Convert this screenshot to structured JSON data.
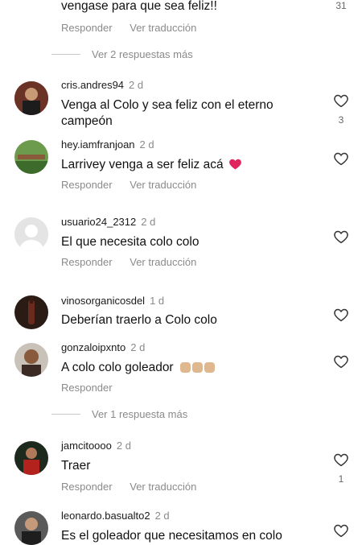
{
  "top_comment": {
    "text": "vengase para que sea feliz!!",
    "reply_label": "Responder",
    "translate_label": "Ver traducción",
    "likes": "31"
  },
  "replies_1": "Ver 2 respuestas más",
  "comments": [
    {
      "user": "cris.andres94",
      "when": "2 d",
      "text": "Venga al Colo y sea feliz con el eterno campeón",
      "likes": "3"
    },
    {
      "user": "hey.iamfranjoan",
      "when": "2 d",
      "text": "Larrivey venga a ser feliz acá",
      "reply_label": "Responder",
      "translate_label": "Ver traducción"
    },
    {
      "user": "usuario24_2312",
      "when": "2 d",
      "text": "El que necesita colo colo",
      "reply_label": "Responder",
      "translate_label": "Ver traducción"
    },
    {
      "user": "vinosorganicosdel",
      "when": "1 d",
      "text": "Deberían traerlo a Colo colo"
    },
    {
      "user": "gonzaloipxnto",
      "when": "2 d",
      "text": "A colo colo goleador",
      "reply_label": "Responder"
    },
    {
      "user": "jamcitoooo",
      "when": "2 d",
      "text": "Traer",
      "reply_label": "Responder",
      "translate_label": "Ver traducción",
      "likes": "1"
    },
    {
      "user": "leonardo.basualto2",
      "when": "2 d",
      "text": "Es el goleador que necesitamos en colo"
    }
  ],
  "replies_2": "Ver 1 respuesta más",
  "icons": {
    "like": "heart-outline-icon",
    "red_heart": "red-heart-emoji",
    "muscle": "flexed-biceps-emoji"
  },
  "colors": {
    "muted": "#8a8a8a",
    "heart_red": "#e0245e"
  }
}
